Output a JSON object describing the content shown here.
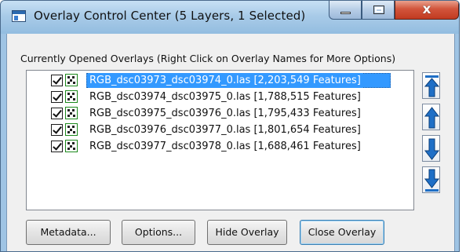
{
  "window": {
    "title": "Overlay Control Center (5 Layers, 1 Selected)",
    "close_glyph": "x"
  },
  "overlays": {
    "group_label": "Currently Opened Overlays (Right Click on Overlay Names for More Options)",
    "items": [
      {
        "label": "RGB_dsc03973_dsc03974_0.las [2,203,549 Features]",
        "checked": true,
        "selected": true
      },
      {
        "label": "RGB_dsc03974_dsc03975_0.las [1,788,515 Features]",
        "checked": true,
        "selected": false
      },
      {
        "label": "RGB_dsc03975_dsc03976_0.las [1,795,433 Features]",
        "checked": true,
        "selected": false
      },
      {
        "label": "RGB_dsc03976_dsc03977_0.las [1,801,654 Features]",
        "checked": true,
        "selected": false
      },
      {
        "label": "RGB_dsc03977_dsc03978_0.las [1,688,461 Features]",
        "checked": true,
        "selected": false
      }
    ]
  },
  "buttons": {
    "metadata": "Metadata...",
    "options": "Options...",
    "hide_overlay": "Hide Overlay",
    "close_overlay": "Close Overlay"
  },
  "icons": {
    "move_top": "move-to-top-icon",
    "move_up": "move-up-icon",
    "move_down": "move-down-icon",
    "move_bottom": "move-to-bottom-icon"
  },
  "colors": {
    "selection": "#3399ff",
    "title_bar": "#a9cbe8",
    "close_button": "#c94a30",
    "arrow_blue": "#1f6fc6"
  }
}
